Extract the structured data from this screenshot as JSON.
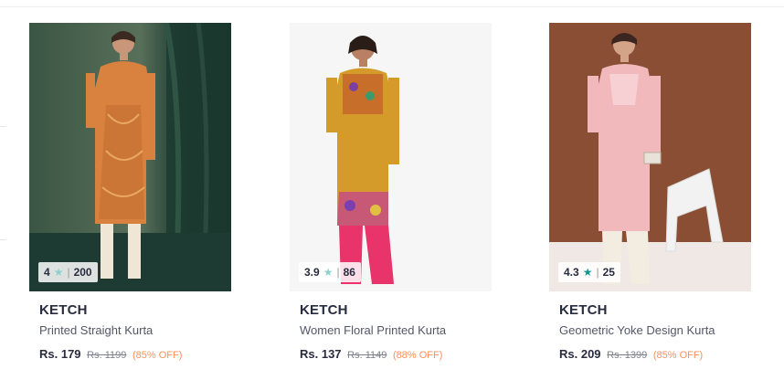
{
  "products": [
    {
      "brand": "KETCH",
      "name": "Printed Straight Kurta",
      "price": "Rs. 179",
      "mrp": "Rs. 1199",
      "discount": "(85% OFF)",
      "rating": "4",
      "rating_count": "200",
      "star_color": "#14958f",
      "kurta_color": "#d9823f",
      "bg_color": "#2f4a3c"
    },
    {
      "brand": "KETCH",
      "name": "Women Floral Printed Kurta",
      "price": "Rs. 137",
      "mrp": "Rs. 1149",
      "discount": "(88% OFF)",
      "rating": "3.9",
      "rating_count": "86",
      "star_color": "#14958f",
      "kurta_color": "#d49a2a",
      "bg_color": "#f4f4f4"
    },
    {
      "brand": "KETCH",
      "name": "Geometric Yoke Design Kurta",
      "price": "Rs. 209",
      "mrp": "Rs. 1399",
      "discount": "(85% OFF)",
      "rating": "4.3",
      "rating_count": "25",
      "star_color": "#14958f",
      "kurta_color": "#f2b9bd",
      "bg_color": "#8a4e35"
    }
  ]
}
